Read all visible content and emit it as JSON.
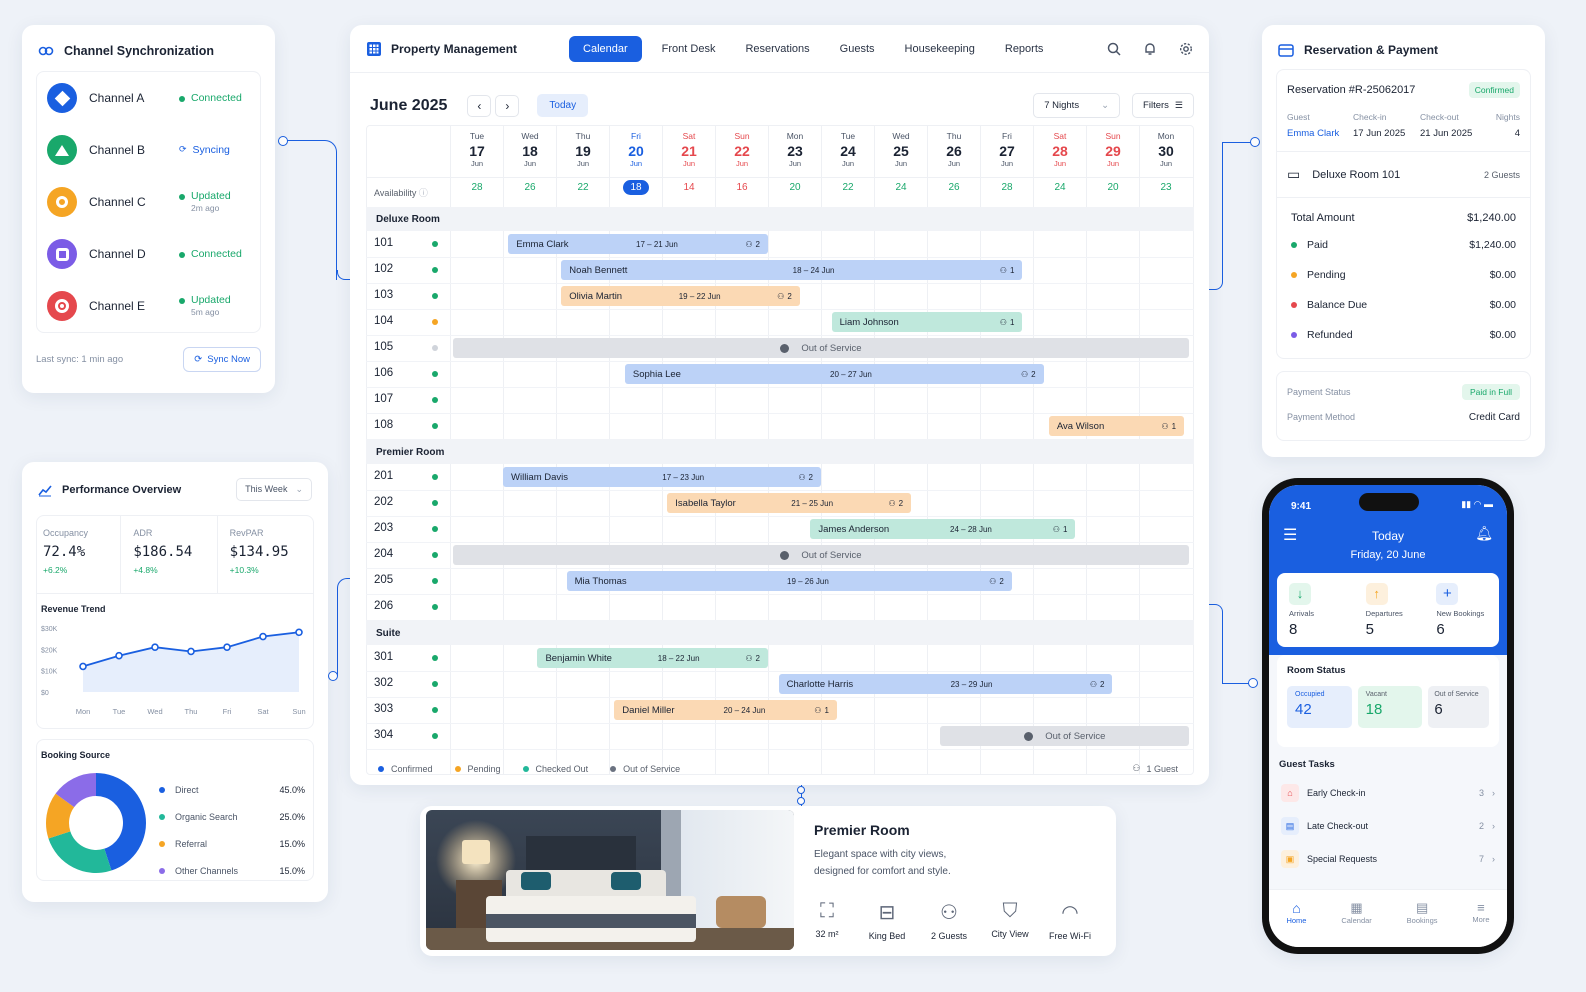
{
  "channel": {
    "title": "Channel Synchronization",
    "items": [
      {
        "name": "Channel A",
        "status": "Connected",
        "sub": "",
        "color": "#1a5fe0",
        "icon": "diamond-icon"
      },
      {
        "name": "Channel B",
        "status": "Syncing",
        "sub": "",
        "color": "#19a86b",
        "icon": "triangle-icon"
      },
      {
        "name": "Channel C",
        "status": "Updated",
        "sub": "2m ago",
        "color": "#f5a524",
        "icon": "circle-icon"
      },
      {
        "name": "Channel D",
        "status": "Connected",
        "sub": "",
        "color": "#7b5ce6",
        "icon": "square-icon"
      },
      {
        "name": "Channel E",
        "status": "Updated",
        "sub": "5m ago",
        "color": "#e5484d",
        "icon": "ring-icon"
      }
    ],
    "last_sync": "Last sync: 1 min ago",
    "sync_button": "Sync Now"
  },
  "perf": {
    "title": "Performance Overview",
    "period": "This Week",
    "kpis": [
      {
        "label": "Occupancy",
        "value": "72.4%",
        "delta": "+6.2%"
      },
      {
        "label": "ADR",
        "value": "$186.54",
        "delta": "+4.8%"
      },
      {
        "label": "RevPAR",
        "value": "$134.95",
        "delta": "+10.3%"
      }
    ],
    "trend_title": "Revenue Trend",
    "booking_title": "Booking Source"
  },
  "chart_data": [
    {
      "type": "line",
      "title": "Revenue Trend",
      "categories": [
        "Mon",
        "Tue",
        "Wed",
        "Thu",
        "Fri",
        "Sat",
        "Sun"
      ],
      "values": [
        12,
        17,
        21,
        19,
        21,
        26,
        28
      ],
      "yticks": [
        "$30K",
        "$20K",
        "$10K",
        "$0"
      ],
      "ylim": [
        0,
        30
      ],
      "color": "#1a5fe0"
    },
    {
      "type": "pie",
      "title": "Booking Source",
      "categories": [
        "Direct",
        "Organic Search",
        "Referral",
        "Other Channels"
      ],
      "values": [
        45.0,
        25.0,
        15.0,
        15.0
      ],
      "labels": [
        "45.0%",
        "25.0%",
        "15.0%",
        "15.0%"
      ],
      "colors": [
        "#1a5fe0",
        "#22b89a",
        "#f5a524",
        "#8b6ce8"
      ]
    }
  ],
  "cal": {
    "app_title": "Property Management",
    "nav": [
      "Calendar",
      "Front Desk",
      "Reservations",
      "Guests",
      "Housekeeping",
      "Reports"
    ],
    "month": "June 2025",
    "today": "Today",
    "nights": "7 Nights",
    "filters": "Filters",
    "availability_label": "Availability",
    "days": [
      {
        "d": "Tue",
        "n": "17",
        "a": "28"
      },
      {
        "d": "Wed",
        "n": "18",
        "a": "26"
      },
      {
        "d": "Thu",
        "n": "19",
        "a": "22"
      },
      {
        "d": "Fri",
        "n": "20",
        "a": "18"
      },
      {
        "d": "Sat",
        "n": "21",
        "a": "14"
      },
      {
        "d": "Sun",
        "n": "22",
        "a": "16"
      },
      {
        "d": "Mon",
        "n": "23",
        "a": "20"
      },
      {
        "d": "Tue",
        "n": "24",
        "a": "22"
      },
      {
        "d": "Wed",
        "n": "25",
        "a": "24"
      },
      {
        "d": "Thu",
        "n": "26",
        "a": "26"
      },
      {
        "d": "Fri",
        "n": "27",
        "a": "28"
      },
      {
        "d": "Sat",
        "n": "28",
        "a": "24"
      },
      {
        "d": "Sun",
        "n": "29",
        "a": "20"
      },
      {
        "d": "Mon",
        "n": "30",
        "a": "23"
      }
    ],
    "month_short": "Jun",
    "sections": [
      "Deluxe Room",
      "Premier Room",
      "Suite"
    ],
    "rooms": [
      "101",
      "102",
      "103",
      "104",
      "105",
      "106",
      "107",
      "108",
      "201",
      "202",
      "203",
      "204",
      "205",
      "206",
      "301",
      "302",
      "303",
      "304"
    ],
    "bookings": [
      {
        "name": "Emma Clark",
        "dates": "17 – 21 Jun",
        "guests": "2"
      },
      {
        "name": "Noah Bennett",
        "dates": "18 – 24 Jun",
        "guests": "1"
      },
      {
        "name": "Olivia Martin",
        "dates": "19 – 22 Jun",
        "guests": "2"
      },
      {
        "name": "Liam Johnson",
        "dates": "",
        "guests": "1"
      },
      {
        "name": "Sophia Lee",
        "dates": "20 – 27 Jun",
        "guests": "2"
      },
      {
        "name": "Ava Wilson",
        "dates": "",
        "guests": "1"
      },
      {
        "name": "William Davis",
        "dates": "17 – 23 Jun",
        "guests": "2"
      },
      {
        "name": "Isabella Taylor",
        "dates": "21 – 25 Jun",
        "guests": "2"
      },
      {
        "name": "James Anderson",
        "dates": "24 – 28 Jun",
        "guests": "1"
      },
      {
        "name": "Mia Thomas",
        "dates": "19 – 26 Jun",
        "guests": "2"
      },
      {
        "name": "Benjamin White",
        "dates": "18 – 22 Jun",
        "guests": "2"
      },
      {
        "name": "Charlotte Harris",
        "dates": "23 – 29 Jun",
        "guests": "2"
      },
      {
        "name": "Daniel Miller",
        "dates": "20 – 24 Jun",
        "guests": "1"
      }
    ],
    "oos": "Out of Service",
    "legend": [
      "Confirmed",
      "Pending",
      "Checked Out",
      "Out of Service"
    ],
    "legend_guest": "1 Guest"
  },
  "resv": {
    "title": "Reservation & Payment",
    "number": "Reservation #R-25062017",
    "status": "Confirmed",
    "cols": [
      "Guest",
      "Check-in",
      "Check-out",
      "Nights"
    ],
    "vals": [
      "Emma Clark",
      "17 Jun 2025",
      "21 Jun 2025",
      "4"
    ],
    "room": "Deluxe Room 101",
    "guests": "2 Guests",
    "total_label": "Total Amount",
    "total": "$1,240.00",
    "lines": [
      {
        "label": "Paid",
        "value": "$1,240.00",
        "color": "#19a86b"
      },
      {
        "label": "Pending",
        "value": "$0.00",
        "color": "#f5a524"
      },
      {
        "label": "Balance Due",
        "value": "$0.00",
        "color": "#e5484d"
      },
      {
        "label": "Refunded",
        "value": "$0.00",
        "color": "#7b5ce6"
      }
    ],
    "pay_status_label": "Payment Status",
    "pay_status": "Paid in Full",
    "pay_method_label": "Payment Method",
    "pay_method": "Credit Card"
  },
  "phone": {
    "time": "9:41",
    "header_title": "Today",
    "header_date": "Friday, 20 June",
    "stats": [
      {
        "label": "Arrivals",
        "value": "8"
      },
      {
        "label": "Departures",
        "value": "5"
      },
      {
        "label": "New Bookings",
        "value": "6"
      }
    ],
    "room_status_title": "Room Status",
    "room_status": [
      {
        "label": "Occupied",
        "value": "42"
      },
      {
        "label": "Vacant",
        "value": "18"
      },
      {
        "label": "Out of Service",
        "value": "6"
      }
    ],
    "tasks_title": "Guest Tasks",
    "tasks": [
      {
        "label": "Early Check-in",
        "count": "3"
      },
      {
        "label": "Late Check-out",
        "count": "2"
      },
      {
        "label": "Special Requests",
        "count": "7"
      }
    ],
    "tabs": [
      "Home",
      "Calendar",
      "Bookings",
      "More"
    ]
  },
  "room": {
    "title": "Premier Room",
    "desc1": "Elegant space with city views,",
    "desc2": "designed for comfort and style.",
    "amenities": [
      {
        "label": "32 m²",
        "icon": "expand-icon"
      },
      {
        "label": "King Bed",
        "icon": "bed-icon"
      },
      {
        "label": "2 Guests",
        "icon": "guests-icon"
      },
      {
        "label": "City View",
        "icon": "bookmark-icon"
      },
      {
        "label": "Free Wi-Fi",
        "icon": "wifi-icon"
      }
    ]
  }
}
